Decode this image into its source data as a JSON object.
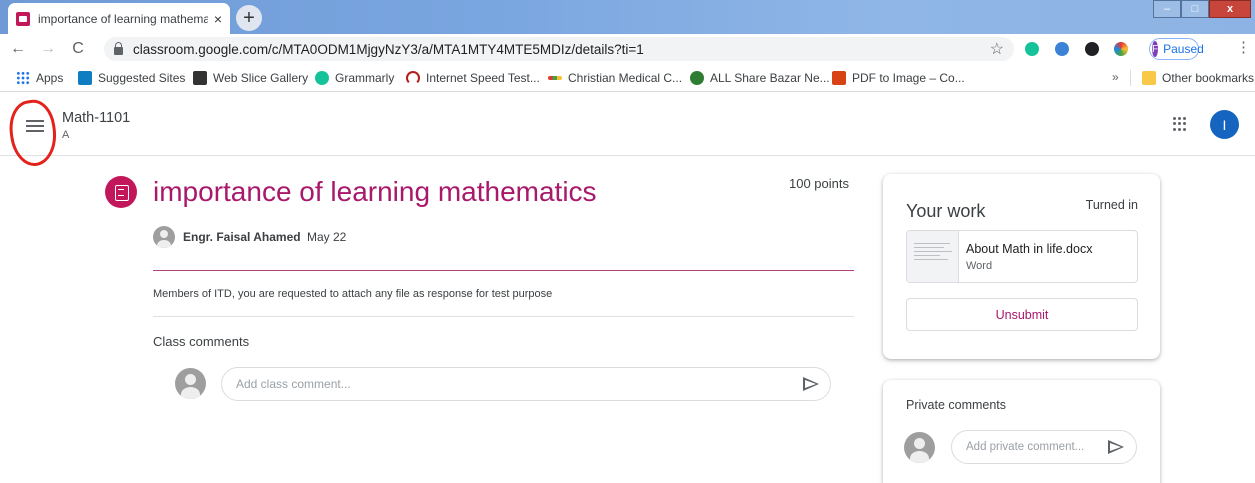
{
  "browser": {
    "tab_title": "importance of learning mathema",
    "tab_close": "×",
    "new_tab": "+",
    "url": "classroom.google.com/c/MTA0ODM1MjgyNzY3/a/MTA1MTY4MTE5MDIz/details?ti=1",
    "back": "←",
    "forward": "→",
    "reload": "C",
    "star": "☆",
    "profile_initial": "F",
    "profile_status": "Paused",
    "menu": "⋮",
    "window_min": "–",
    "window_max": "□",
    "window_close": "x"
  },
  "bookmarks": {
    "items": [
      {
        "label": "Apps",
        "color": "#1a73e8"
      },
      {
        "label": "Suggested Sites",
        "color": "#0f7dc2"
      },
      {
        "label": "Web Slice Gallery",
        "color": "#333333"
      },
      {
        "label": "Grammarly",
        "color": "#15c39a"
      },
      {
        "label": "Internet Speed Test...",
        "color": "#b71c1c"
      },
      {
        "label": "Christian Medical C...",
        "color": "#e53935"
      },
      {
        "label": "ALL Share Bazar Ne...",
        "color": "#2e7d32"
      },
      {
        "label": "PDF to Image – Co...",
        "color": "#d84315"
      }
    ],
    "more": "»",
    "other": "Other bookmarks",
    "other_color": "#f9c846"
  },
  "header": {
    "class_name": "Math-1101",
    "section": "A",
    "user_initial": "I"
  },
  "assignment": {
    "title": "importance of learning mathematics",
    "points": "100 points",
    "author": "Engr. Faisal Ahamed",
    "date": "May 22",
    "description": "Members of ITD, you are requested to attach any file as response for test purpose",
    "class_comments_label": "Class comments",
    "class_comment_placeholder": "Add class comment..."
  },
  "your_work": {
    "title": "Your work",
    "status": "Turned in",
    "attachment_name": "About Math in life.docx",
    "attachment_type": "Word",
    "unsubmit_label": "Unsubmit"
  },
  "private_comments": {
    "title": "Private comments",
    "placeholder": "Add private comment..."
  },
  "colors": {
    "accent": "#a8186b",
    "assignment_icon": "#c2185b",
    "user_avatar": "#1565c0"
  }
}
